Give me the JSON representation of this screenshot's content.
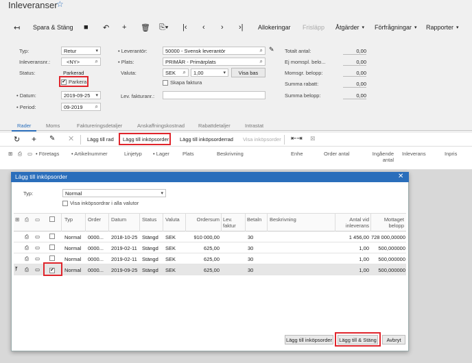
{
  "page": {
    "title": "Inleveranser"
  },
  "toolbar": {
    "save_close": "Spara & Stäng",
    "allocations": "Allokeringar",
    "release": "Frisläpp",
    "actions": "Åtgärder",
    "inquiries": "Förfrågningar",
    "reports": "Rapporter"
  },
  "form": {
    "type_label": "Typ:",
    "type_value": "Retur",
    "receipt_nbr_label": "Inleveransnr.:",
    "receipt_nbr_value": "<NY>",
    "status_label": "Status:",
    "status_value": "Parkerad",
    "hold_label": "Parkera",
    "date_label": "Datum:",
    "date_value": "2019-09-25",
    "period_label": "Period:",
    "period_value": "09-2019",
    "vendor_label": "Leverantör:",
    "vendor_value": "50000 - Svensk leverantör",
    "location_label": "Plats:",
    "location_value": "PRIMÄR - Primärplats",
    "currency_label": "Valuta:",
    "currency_value": "SEK",
    "rate_value": "1,00",
    "base_currency_btn": "Visa bas",
    "create_invoice_label": "Skapa faktura",
    "vendor_ref_label": "Lev. fakturanr.:",
    "total_qty_label": "Totalt antal:",
    "total_qty_value": "0,00",
    "unbilled_label": "Ej momspl. belo...",
    "unbilled_value": "0,00",
    "vat_label": "Momsgr. belopp:",
    "vat_value": "0,00",
    "discount_label": "Summa rabatt:",
    "discount_value": "0,00",
    "total_amount_label": "Summa belopp:",
    "total_amount_value": "0,00"
  },
  "tabs": [
    "Rader",
    "Moms",
    "Faktureringsdetaljer",
    "Anskaffningskostnad",
    "Rabattdetaljer",
    "Intrastat"
  ],
  "grid_toolbar": {
    "add_row": "Lägg till rad",
    "add_po": "Lägg till inköpsorder",
    "add_po_line": "Lägg till inköpsorderrad",
    "view_po": "Visa inköpsorder"
  },
  "grid_headers": [
    "Företags",
    "Artikelnummer",
    "Linjetyp",
    "Lager",
    "Plats",
    "Beskrivning",
    "Enhe",
    "Order antal",
    "Ingående antal",
    "Inleverans",
    "Inpris"
  ],
  "dialog": {
    "title": "Lägg till inköpsorder",
    "type_label": "Typ:",
    "type_value": "Normal",
    "show_all_label": "Visa inköpsordrar i alla valutor",
    "headers": [
      "Typ",
      "Order",
      "Datum",
      "Status",
      "Valuta",
      "Ordersum",
      "Lev. faktur",
      "Betaln",
      "Beskrivning",
      "Antal vid inleverans",
      "Mottaget belopp"
    ],
    "rows": [
      {
        "type": "Normal",
        "order": "0000...",
        "date": "2018-10-25",
        "status": "Stängd",
        "currency": "SEK",
        "total": "910 000,00",
        "terms": "30",
        "qty": "1 456,00",
        "amount": "728 000,00000"
      },
      {
        "type": "Normal",
        "order": "0000...",
        "date": "2019-02-11",
        "status": "Stängd",
        "currency": "SEK",
        "total": "625,00",
        "terms": "30",
        "qty": "1,00",
        "amount": "500,000000"
      },
      {
        "type": "Normal",
        "order": "0000...",
        "date": "2019-02-11",
        "status": "Stängd",
        "currency": "SEK",
        "total": "625,00",
        "terms": "30",
        "qty": "1,00",
        "amount": "500,000000"
      },
      {
        "type": "Normal",
        "order": "0000...",
        "date": "2019-09-25",
        "status": "Stängd",
        "currency": "SEK",
        "total": "625,00",
        "terms": "30",
        "qty": "1,00",
        "amount": "500,000000"
      }
    ],
    "btn_add": "Lägg till inköpsorder",
    "btn_add_close": "Lägg till & Stäng",
    "btn_cancel": "Avbryt"
  }
}
